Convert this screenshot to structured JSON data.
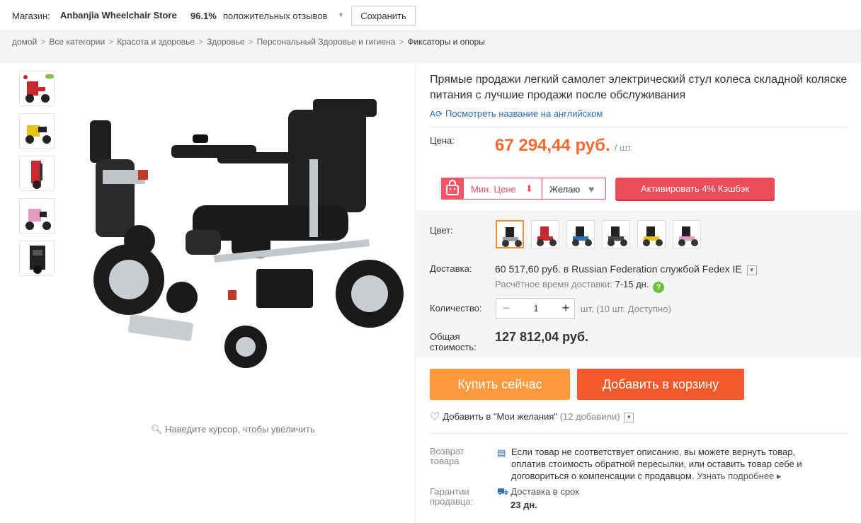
{
  "store": {
    "label": "Магазин:",
    "name": "Anbanjia Wheelchair Store",
    "rating": "96.1%",
    "feedback": "положительных отзывов",
    "save_button": "Сохранить"
  },
  "breadcrumbs": [
    "домой",
    "Все категории",
    "Красота и здоровье",
    "Здоровье",
    "Персональный Здоровье и гигиена",
    "Фиксаторы и опоры"
  ],
  "gallery": {
    "thumbnails": [
      "red-wheelchair",
      "yellow-wheelchair",
      "red-folded-wheelchair",
      "pink-wheelchair",
      "black-folded-wheelchair"
    ],
    "zoom_hint": "Наведите курсор, чтобы увеличить"
  },
  "product": {
    "title": "Прямые продажи легкий самолет электрический стул колеса складной коляске питания с лучшие продажи после обслуживания",
    "translate_link": "Посмотреть название на английском",
    "price_label": "Цена:",
    "price": "67 294,44 руб.",
    "price_unit": "/ шт.",
    "min_price_label": "Мин. Цене",
    "wish_label": "Желаю",
    "cashback_button": "Активировать 4% Кэшбэк",
    "color_label": "Цвет:",
    "colors": [
      "silver",
      "red",
      "blue",
      "black",
      "yellow",
      "pink"
    ],
    "colors_hex": [
      "#9aa0a6",
      "#c8282e",
      "#2e6fb5",
      "#222222",
      "#e8c21c",
      "#e59bc0"
    ],
    "shipping_label": "Доставка:",
    "shipping_price": "60 517,60 руб.",
    "shipping_to": "в Russian Federation службой Fedex IE",
    "eta_label": "Расчётное время доставки:",
    "eta_value": "7-15 дн.",
    "eta_help": "?",
    "quantity_label": "Количество:",
    "quantity": "1",
    "quantity_available": "шт. (10 шт. Доступно)",
    "total_label": "Общая стоимость:",
    "total": "127 812,04 руб.",
    "buy_now": "Купить сейчас",
    "add_to_cart": "Добавить в корзину",
    "wishlist_text": "Добавить в \"Мои желания\"",
    "wishlist_count": "(12 добавили)",
    "return_label": "Возврат товара",
    "return_text": "Если товар не соответствует описанию, вы можете вернуть товар, оплатив стоимость обратной пересылки, или оставить товар себе и договориться о компенсации с продавцом.",
    "return_more": "Узнать подробнее",
    "guarantee_label": "Гарантии продавца:",
    "guarantee_text": "Доставка в срок",
    "guarantee_days": "23 дн."
  },
  "colors": {
    "price": "#f36a34",
    "buy_now": "#fd9a3f",
    "add_to_cart": "#f3592a",
    "cashback": "#ec4b5a",
    "link": "#2a6bb8"
  }
}
